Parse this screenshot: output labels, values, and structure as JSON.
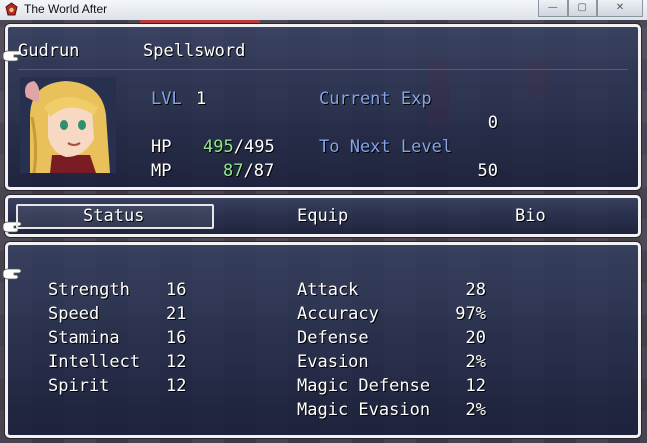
{
  "window": {
    "title": "The World After",
    "minimize": "—",
    "maximize": "▢",
    "close": "✕"
  },
  "character": {
    "name": "Gudrun",
    "class": "Spellsword"
  },
  "level": {
    "label": "LVL",
    "value": "1"
  },
  "hp": {
    "label": "HP",
    "current": "495",
    "sep": "/",
    "max": "495"
  },
  "mp": {
    "label": "MP",
    "current": "87",
    "sep": "/",
    "max": "87"
  },
  "exp": {
    "current_label": "Current Exp",
    "current_value": "0",
    "next_label": "To Next Level",
    "next_value": "50"
  },
  "tabs": {
    "status": "Status",
    "equip": "Equip",
    "bio": "Bio"
  },
  "stats": [
    {
      "name": "Strength",
      "value": "16"
    },
    {
      "name": "Speed",
      "value": "21"
    },
    {
      "name": "Stamina",
      "value": "16"
    },
    {
      "name": "Intellect",
      "value": "12"
    },
    {
      "name": "Spirit",
      "value": "12"
    }
  ],
  "combat": [
    {
      "name": "Attack",
      "value": "28"
    },
    {
      "name": "Accuracy",
      "value": "97%"
    },
    {
      "name": "Defense",
      "value": "20"
    },
    {
      "name": "Evasion",
      "value": "2%"
    },
    {
      "name": "Magic Defense",
      "value": "12"
    },
    {
      "name": "Magic Evasion",
      "value": "2%"
    }
  ],
  "icons": {
    "app": "game-app-icon",
    "cursor": "pointing-hand-icon"
  },
  "colors": {
    "label_blue": "#84a4e6",
    "value_green": "#8ee88a",
    "panel_border": "#f2f2f2"
  }
}
